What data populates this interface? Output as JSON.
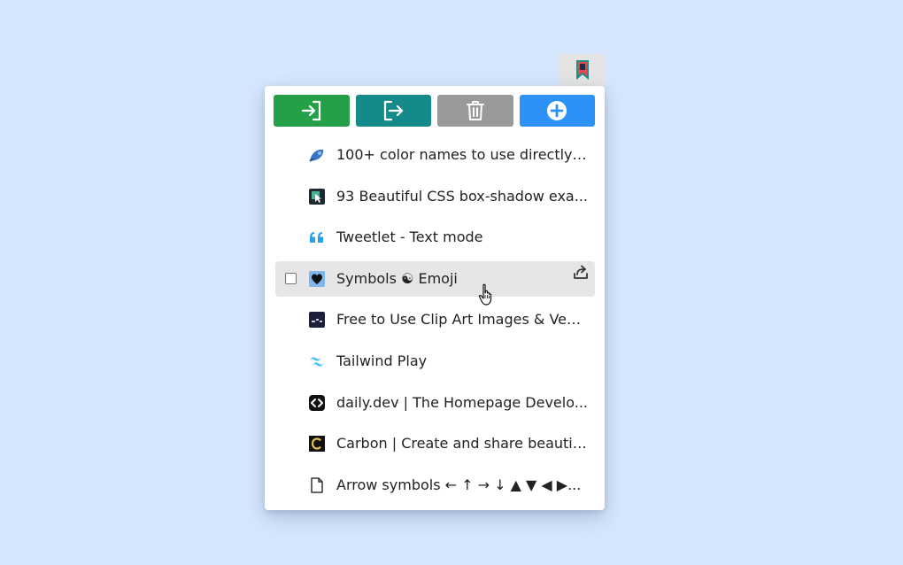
{
  "toolbar": {
    "buttons": [
      {
        "name": "import",
        "icon": "sign-in-icon",
        "color": "#24a148"
      },
      {
        "name": "export",
        "icon": "sign-out-icon",
        "color": "#148a8a"
      },
      {
        "name": "delete",
        "icon": "trash-icon",
        "color": "#9a9a9a"
      },
      {
        "name": "add",
        "icon": "plus-circle-icon",
        "color": "#2d92f5"
      }
    ]
  },
  "bookmarks": [
    {
      "title": "100+ color names to use directly ...",
      "icon": "paint-brush-icon"
    },
    {
      "title": "93 Beautiful CSS box-shadow exa...",
      "icon": "cursor-box-icon"
    },
    {
      "title": "Tweetlet - Text mode",
      "icon": "quote-icon"
    },
    {
      "title": "Symbols ☯ Emoji",
      "icon": "heart-icon"
    },
    {
      "title": "Free to Use Clip Art Images & Vec...",
      "icon": "openclipart-icon"
    },
    {
      "title": "Tailwind Play",
      "icon": "tailwind-icon"
    },
    {
      "title": "daily.dev | The Homepage Develo...",
      "icon": "dailydev-icon"
    },
    {
      "title": "Carbon | Create and share beautif...",
      "icon": "carbon-icon"
    },
    {
      "title": "Arrow symbols ← ↑ → ↓ ▲ ▼ ◀ ▶...",
      "icon": "document-icon"
    }
  ],
  "colors": {
    "background": "#d6e6fd",
    "hover_row": "#e6e6e8"
  }
}
